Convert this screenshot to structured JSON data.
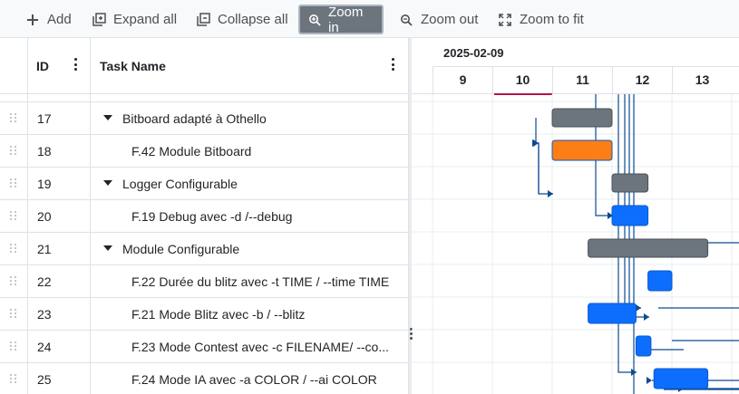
{
  "toolbar": {
    "add": "Add",
    "expand_all": "Expand all",
    "collapse_all": "Collapse all",
    "zoom_in": "Zoom in",
    "zoom_out": "Zoom out",
    "zoom_to_fit": "Zoom to fit",
    "active_item": "zoom_in"
  },
  "grid": {
    "col_id": "ID",
    "col_name": "Task Name",
    "rows": [
      {
        "id": "17",
        "name": "Bitboard adapté à Othello",
        "parent": true,
        "expanded": true
      },
      {
        "id": "18",
        "name": "F.42 Module Bitboard",
        "parent": false
      },
      {
        "id": "19",
        "name": "Logger Configurable",
        "parent": true,
        "expanded": true
      },
      {
        "id": "20",
        "name": "F.19 Debug avec -d /--debug",
        "parent": false
      },
      {
        "id": "21",
        "name": "Module Configurable",
        "parent": true,
        "expanded": true
      },
      {
        "id": "22",
        "name": "F.22 Durée du blitz avec -t TIME / --time TIME",
        "parent": false
      },
      {
        "id": "23",
        "name": "F.21 Mode Blitz avec -b / --blitz",
        "parent": false
      },
      {
        "id": "24",
        "name": "F.23 Mode Contest avec -c FILENAME/ --co...",
        "parent": false
      },
      {
        "id": "25",
        "name": "F.24 Mode IA avec -a COLOR / --ai COLOR",
        "parent": false
      }
    ]
  },
  "timeline": {
    "month": "2025-02-09",
    "days": [
      "9",
      "10",
      "11",
      "12",
      "13"
    ],
    "today": "10"
  },
  "colors": {
    "summary": "#6c757d",
    "task": "#0d6efd",
    "highlight": "#fd7e14",
    "link": "#0d4a94",
    "today": "#b3124f"
  },
  "bars": [
    {
      "row": 0,
      "kind": "summary",
      "start": 11.0,
      "end": 12.0
    },
    {
      "row": 1,
      "kind": "highlight",
      "start": 11.0,
      "end": 12.0
    },
    {
      "row": 2,
      "kind": "summary",
      "start": 12.0,
      "end": 12.6
    },
    {
      "row": 3,
      "kind": "task",
      "start": 12.0,
      "end": 12.6
    },
    {
      "row": 4,
      "kind": "summary",
      "start": 11.6,
      "end": 13.6
    },
    {
      "row": 5,
      "kind": "task",
      "start": 12.6,
      "end": 13.0
    },
    {
      "row": 6,
      "kind": "task",
      "start": 11.6,
      "end": 12.4
    },
    {
      "row": 7,
      "kind": "task",
      "start": 12.4,
      "end": 12.65
    },
    {
      "row": 8,
      "kind": "task",
      "start": 12.7,
      "end": 13.6
    }
  ]
}
